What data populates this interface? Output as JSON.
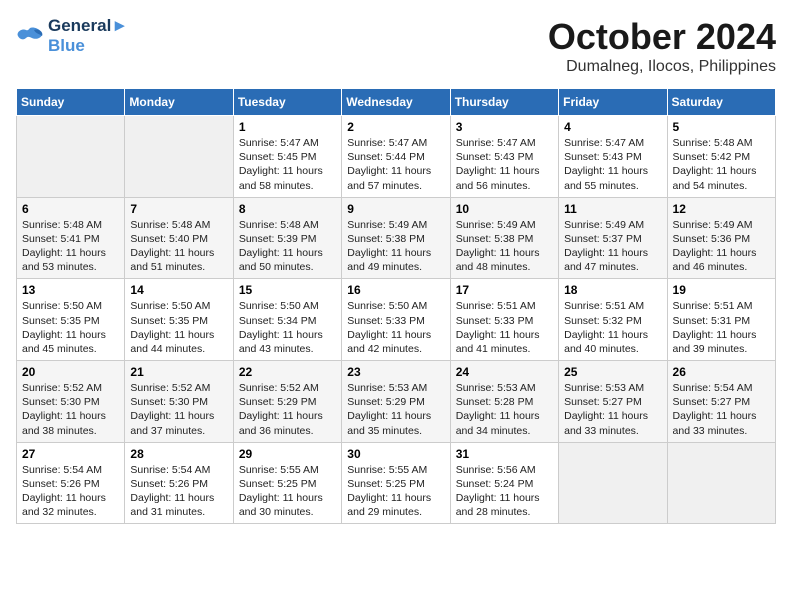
{
  "logo": {
    "line1": "General",
    "line2": "Blue"
  },
  "title": "October 2024",
  "location": "Dumalneg, Ilocos, Philippines",
  "days_header": [
    "Sunday",
    "Monday",
    "Tuesday",
    "Wednesday",
    "Thursday",
    "Friday",
    "Saturday"
  ],
  "weeks": [
    [
      {
        "day": "",
        "text": ""
      },
      {
        "day": "",
        "text": ""
      },
      {
        "day": "1",
        "text": "Sunrise: 5:47 AM\nSunset: 5:45 PM\nDaylight: 11 hours and 58 minutes."
      },
      {
        "day": "2",
        "text": "Sunrise: 5:47 AM\nSunset: 5:44 PM\nDaylight: 11 hours and 57 minutes."
      },
      {
        "day": "3",
        "text": "Sunrise: 5:47 AM\nSunset: 5:43 PM\nDaylight: 11 hours and 56 minutes."
      },
      {
        "day": "4",
        "text": "Sunrise: 5:47 AM\nSunset: 5:43 PM\nDaylight: 11 hours and 55 minutes."
      },
      {
        "day": "5",
        "text": "Sunrise: 5:48 AM\nSunset: 5:42 PM\nDaylight: 11 hours and 54 minutes."
      }
    ],
    [
      {
        "day": "6",
        "text": "Sunrise: 5:48 AM\nSunset: 5:41 PM\nDaylight: 11 hours and 53 minutes."
      },
      {
        "day": "7",
        "text": "Sunrise: 5:48 AM\nSunset: 5:40 PM\nDaylight: 11 hours and 51 minutes."
      },
      {
        "day": "8",
        "text": "Sunrise: 5:48 AM\nSunset: 5:39 PM\nDaylight: 11 hours and 50 minutes."
      },
      {
        "day": "9",
        "text": "Sunrise: 5:49 AM\nSunset: 5:38 PM\nDaylight: 11 hours and 49 minutes."
      },
      {
        "day": "10",
        "text": "Sunrise: 5:49 AM\nSunset: 5:38 PM\nDaylight: 11 hours and 48 minutes."
      },
      {
        "day": "11",
        "text": "Sunrise: 5:49 AM\nSunset: 5:37 PM\nDaylight: 11 hours and 47 minutes."
      },
      {
        "day": "12",
        "text": "Sunrise: 5:49 AM\nSunset: 5:36 PM\nDaylight: 11 hours and 46 minutes."
      }
    ],
    [
      {
        "day": "13",
        "text": "Sunrise: 5:50 AM\nSunset: 5:35 PM\nDaylight: 11 hours and 45 minutes."
      },
      {
        "day": "14",
        "text": "Sunrise: 5:50 AM\nSunset: 5:35 PM\nDaylight: 11 hours and 44 minutes."
      },
      {
        "day": "15",
        "text": "Sunrise: 5:50 AM\nSunset: 5:34 PM\nDaylight: 11 hours and 43 minutes."
      },
      {
        "day": "16",
        "text": "Sunrise: 5:50 AM\nSunset: 5:33 PM\nDaylight: 11 hours and 42 minutes."
      },
      {
        "day": "17",
        "text": "Sunrise: 5:51 AM\nSunset: 5:33 PM\nDaylight: 11 hours and 41 minutes."
      },
      {
        "day": "18",
        "text": "Sunrise: 5:51 AM\nSunset: 5:32 PM\nDaylight: 11 hours and 40 minutes."
      },
      {
        "day": "19",
        "text": "Sunrise: 5:51 AM\nSunset: 5:31 PM\nDaylight: 11 hours and 39 minutes."
      }
    ],
    [
      {
        "day": "20",
        "text": "Sunrise: 5:52 AM\nSunset: 5:30 PM\nDaylight: 11 hours and 38 minutes."
      },
      {
        "day": "21",
        "text": "Sunrise: 5:52 AM\nSunset: 5:30 PM\nDaylight: 11 hours and 37 minutes."
      },
      {
        "day": "22",
        "text": "Sunrise: 5:52 AM\nSunset: 5:29 PM\nDaylight: 11 hours and 36 minutes."
      },
      {
        "day": "23",
        "text": "Sunrise: 5:53 AM\nSunset: 5:29 PM\nDaylight: 11 hours and 35 minutes."
      },
      {
        "day": "24",
        "text": "Sunrise: 5:53 AM\nSunset: 5:28 PM\nDaylight: 11 hours and 34 minutes."
      },
      {
        "day": "25",
        "text": "Sunrise: 5:53 AM\nSunset: 5:27 PM\nDaylight: 11 hours and 33 minutes."
      },
      {
        "day": "26",
        "text": "Sunrise: 5:54 AM\nSunset: 5:27 PM\nDaylight: 11 hours and 33 minutes."
      }
    ],
    [
      {
        "day": "27",
        "text": "Sunrise: 5:54 AM\nSunset: 5:26 PM\nDaylight: 11 hours and 32 minutes."
      },
      {
        "day": "28",
        "text": "Sunrise: 5:54 AM\nSunset: 5:26 PM\nDaylight: 11 hours and 31 minutes."
      },
      {
        "day": "29",
        "text": "Sunrise: 5:55 AM\nSunset: 5:25 PM\nDaylight: 11 hours and 30 minutes."
      },
      {
        "day": "30",
        "text": "Sunrise: 5:55 AM\nSunset: 5:25 PM\nDaylight: 11 hours and 29 minutes."
      },
      {
        "day": "31",
        "text": "Sunrise: 5:56 AM\nSunset: 5:24 PM\nDaylight: 11 hours and 28 minutes."
      },
      {
        "day": "",
        "text": ""
      },
      {
        "day": "",
        "text": ""
      }
    ]
  ]
}
